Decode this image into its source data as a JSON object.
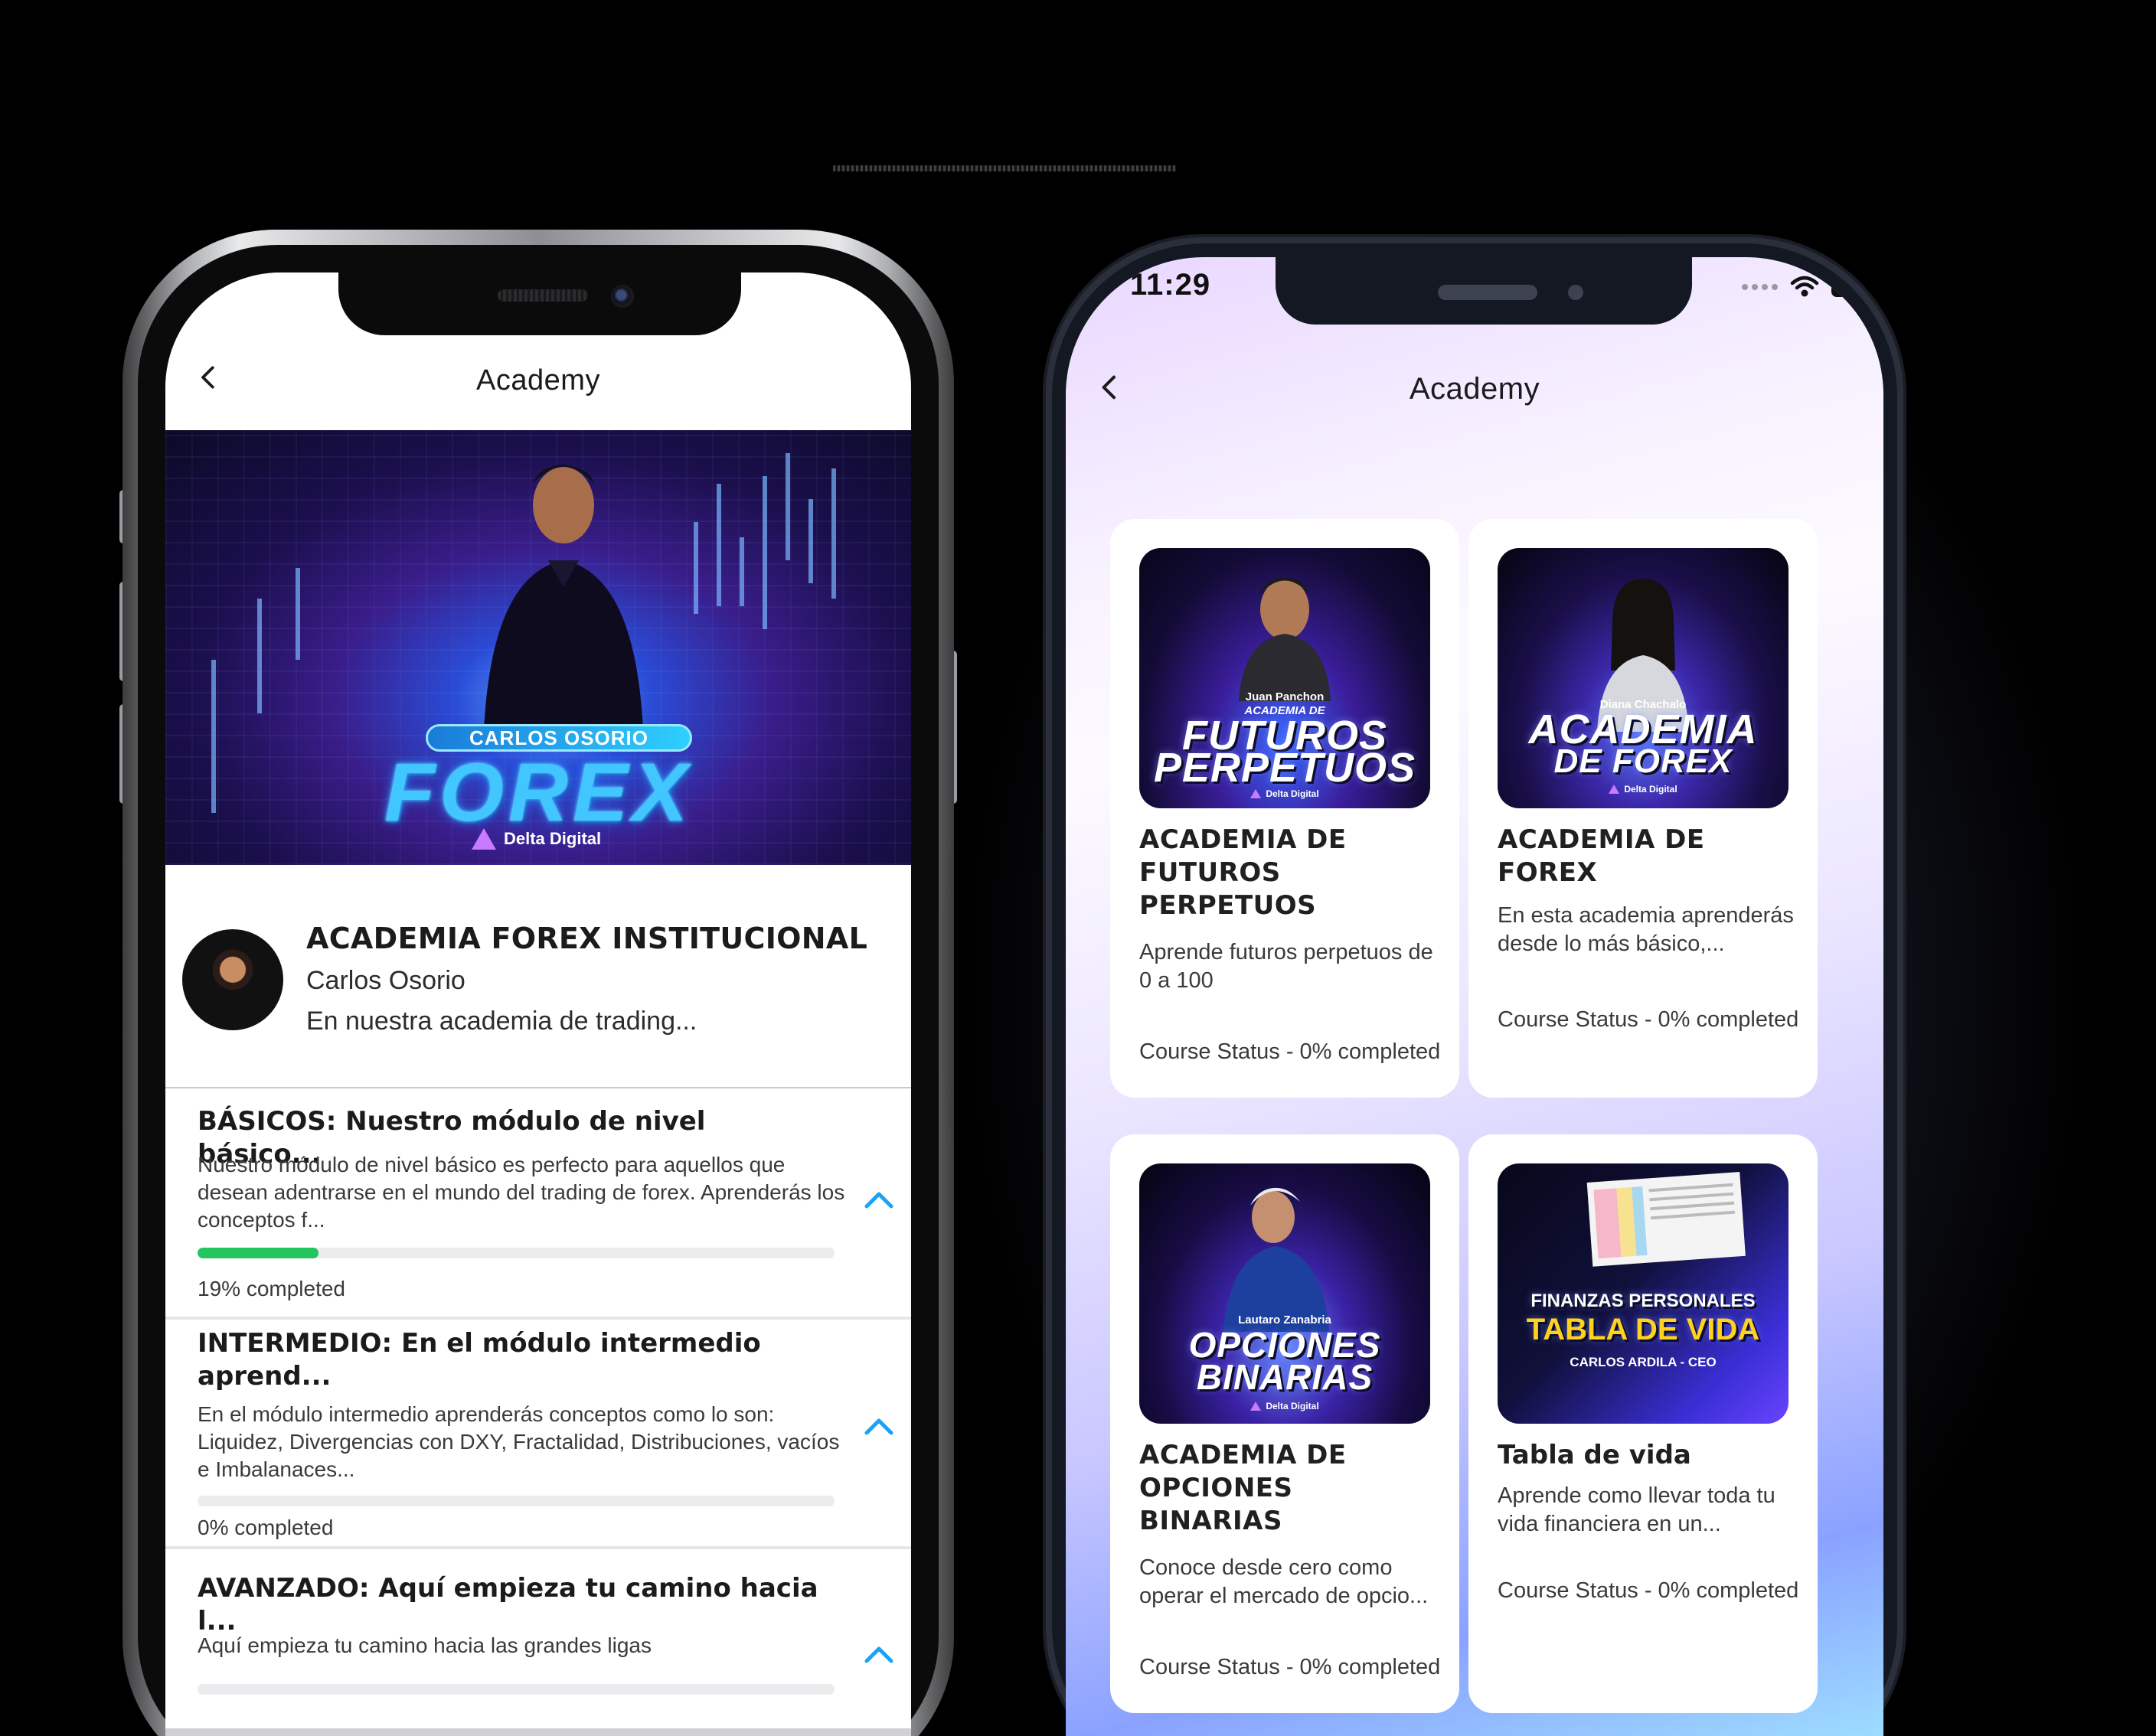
{
  "left_phone": {
    "header": {
      "title": "Academy"
    },
    "banner": {
      "name_tag": "CARLOS OSORIO",
      "headline": "FOREX",
      "brand": "Delta Digital"
    },
    "course": {
      "title": "ACADEMIA FOREX INSTITUCIONAL",
      "author": "Carlos Osorio",
      "description": "En nuestra academia de trading..."
    },
    "modules": [
      {
        "title": "BÁSICOS: Nuestro módulo de nivel básico...",
        "description": "Nuestro módulo de nivel básico es perfecto para aquellos que desean adentrarse en el mundo del trading de forex. Aprenderás los conceptos f...",
        "progress": 0.19,
        "progress_label": "19% completed"
      },
      {
        "title": "INTERMEDIO: En el módulo intermedio aprend...",
        "description": "En el módulo intermedio aprenderás conceptos como lo son: Liquidez, Divergencias con DXY, Fractalidad, Distribuciones, vacíos e Imbalanaces...",
        "progress": 0,
        "progress_label": "0% completed"
      },
      {
        "title": "AVANZADO: Aquí empieza tu camino hacia l...",
        "description": "Aquí empieza tu camino hacia las grandes ligas",
        "progress": 0
      }
    ]
  },
  "right_phone": {
    "status_bar": {
      "time": "11:29"
    },
    "header": {
      "title": "Academy"
    },
    "cards": [
      {
        "thumb": {
          "line1": "Juan Panchon",
          "line1b": "ACADEMIA DE",
          "line2": "FUTUROS",
          "line3": "PERPETUOS",
          "brand": "Delta Digital"
        },
        "title": "ACADEMIA DE FUTUROS PERPETUOS",
        "description": "Aprende futuros perpetuos de 0 a 100",
        "status": "Course Status - 0% completed"
      },
      {
        "thumb": {
          "line1": "Diana Chachalo",
          "line2": "ACADEMIA",
          "line3": "DE FOREX",
          "brand": "Delta Digital"
        },
        "title": "ACADEMIA DE FOREX",
        "description": "En esta academia aprenderás desde lo más básico,...",
        "status": "Course Status - 0% completed"
      },
      {
        "thumb": {
          "line1": "Lautaro Zanabria",
          "line2": "OPCIONES",
          "line3": "BINARIAS",
          "brand": "Delta Digital"
        },
        "title": "ACADEMIA DE OPCIONES BINARIAS",
        "description": "Conoce desde cero como operar el mercado de opcio...",
        "status": "Course Status - 0% completed"
      },
      {
        "thumb": {
          "line1": "FINANZAS PERSONALES",
          "line2": "TABLA DE VIDA",
          "line3": "CARLOS ARDILA - CEO"
        },
        "title": "Tabla de vida",
        "description": "Aprende como llevar toda tu vida financiera en un...",
        "status": "Course Status - 0% completed"
      }
    ]
  },
  "colors": {
    "progress_fill": "#22c55e",
    "chevron": "#1aa3f5",
    "banner_glow": "#41c6ff",
    "brand_accent": "#c87bff"
  },
  "icons": [
    "back-arrow-icon",
    "chevron-up-icon",
    "wifi-icon",
    "battery-icon",
    "signal-icon",
    "delta-logo-icon"
  ]
}
